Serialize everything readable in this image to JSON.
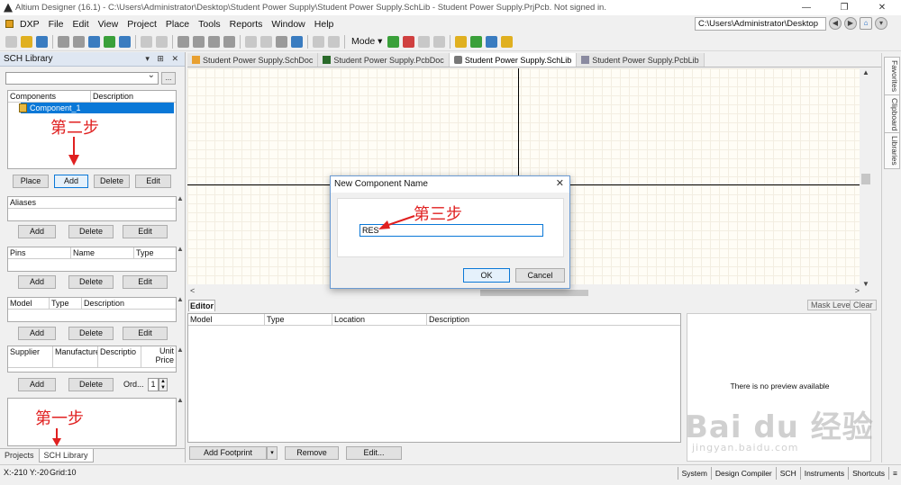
{
  "window": {
    "title": "Altium Designer (16.1) - C:\\Users\\Administrator\\Desktop\\Student Power Supply\\Student Power Supply.SchLib - Student Power Supply.PrjPcb. Not signed in.",
    "controls": [
      "—",
      "❐",
      "✕"
    ]
  },
  "menu": {
    "items": [
      "DXP",
      "File",
      "Edit",
      "View",
      "Project",
      "Place",
      "Tools",
      "Reports",
      "Window",
      "Help"
    ],
    "address": "C:\\Users\\Administrator\\Desktop"
  },
  "toolbar": {
    "mode_label": "Mode ▾"
  },
  "sch_library": {
    "title": "SCH Library",
    "components_header": [
      "Components",
      "Description"
    ],
    "selected_component": "Component_1",
    "component_buttons": [
      "Place",
      "Add",
      "Delete",
      "Edit"
    ],
    "aliases_header": "Aliases",
    "alias_buttons": [
      "Add",
      "Delete",
      "Edit"
    ],
    "pins_header": [
      "Pins",
      "Name",
      "Type"
    ],
    "pin_buttons": [
      "Add",
      "Delete",
      "Edit"
    ],
    "model_header": [
      "Model",
      "Type",
      "Description"
    ],
    "model_buttons": [
      "Add",
      "Delete",
      "Edit"
    ],
    "supplier_header": [
      "Supplier",
      "Manufacture",
      "Descriptio",
      "Unit Price"
    ],
    "supplier_buttons": [
      "Add",
      "Delete"
    ],
    "order_label": "Ord...",
    "order_value": "1",
    "bottom_tabs": [
      "Projects",
      "SCH Library"
    ]
  },
  "doc_tabs": [
    "Student Power Supply.SchDoc",
    "Student Power Supply.PcbDoc",
    "Student Power Supply.SchLib",
    "Student Power Supply.PcbLib"
  ],
  "right_tabs": [
    "Favorites",
    "Clipboard",
    "Libraries"
  ],
  "editor": {
    "tab": "Editor",
    "mask_level": "Mask Level",
    "clear": "Clear",
    "columns": [
      "Model",
      "Type",
      "Location",
      "Description"
    ],
    "preview_message": "There is no preview available",
    "buttons": [
      "Add Footprint",
      "Remove",
      "Edit..."
    ]
  },
  "statusbar": {
    "coords": "X:-210 Y:-20",
    "grid": "Grid:10",
    "buttons": [
      "System",
      "Design Compiler",
      "SCH",
      "Instruments",
      "Shortcuts"
    ]
  },
  "dialog": {
    "title": "New Component Name",
    "input_value": "RES",
    "ok_label": "OK",
    "cancel_label": "Cancel"
  },
  "annotations": {
    "step1": "第一步",
    "step2": "第二步",
    "step3": "第三步",
    "color": "#e02020"
  },
  "watermark": {
    "logo": "Bai du 经验",
    "url": "jingyan.baidu.com"
  }
}
